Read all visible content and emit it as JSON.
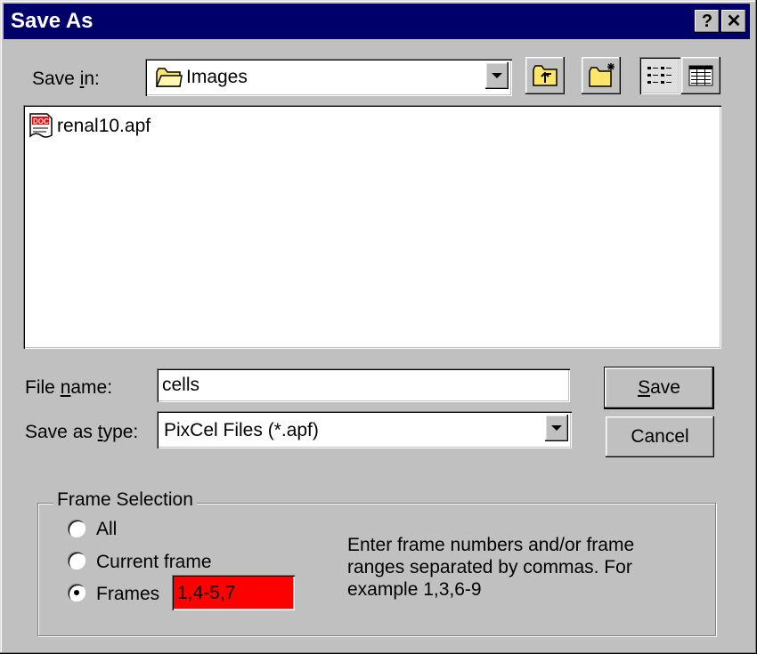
{
  "window": {
    "title": "Save As",
    "help_glyph": "?",
    "close_glyph": "✕"
  },
  "save_in": {
    "label_pre": "Save ",
    "label_u": "i",
    "label_post": "n:",
    "value": "Images"
  },
  "files": [
    {
      "name": "renal10.apf",
      "icon": "doc-icon",
      "icon_text": "DOC"
    }
  ],
  "file_name": {
    "label_pre": "File ",
    "label_u": "n",
    "label_post": "ame:",
    "value": "cells"
  },
  "save_as_type": {
    "label_pre": "Save as ",
    "label_u": "t",
    "label_post": "ype:",
    "value": "PixCel Files (*.apf)"
  },
  "buttons": {
    "save_u": "S",
    "save_rest": "ave",
    "cancel": "Cancel"
  },
  "frame_selection": {
    "title": "Frame Selection",
    "options": [
      "All",
      "Current frame",
      "Frames"
    ],
    "selected": "Frames",
    "frames_value": "1,4-5,7",
    "frames_bg": "#ff0000",
    "hint": [
      "Enter frame numbers and/or frame",
      "ranges separated by commas. For",
      "example 1,3,6-9"
    ]
  },
  "colors": {
    "titlebar": "#00006b",
    "face": "#c0c0c0"
  }
}
